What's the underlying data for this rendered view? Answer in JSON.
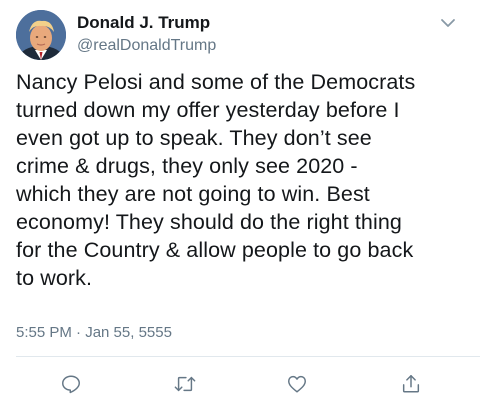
{
  "author": {
    "name": "Donald J. Trump",
    "handle": "@realDonaldTrump"
  },
  "tweet": {
    "text": "Nancy Pelosi and some of the Democrats\nturned down my offer yesterday before I\neven got up to speak. They don’t see\ncrime & drugs, they only see 2020 -\nwhich they are not going to win. Best\neconomy! They should do the right thing\nfor the Country & allow people to go back\nto work.",
    "timestamp": "5:55 PM · Jan 55, 5555"
  },
  "icons": {
    "menu": "chevron-down-icon",
    "reply": "reply-icon",
    "retweet": "retweet-icon",
    "like": "heart-icon",
    "share": "share-icon"
  },
  "colors": {
    "text": "#14171a",
    "secondary": "#657786",
    "divider": "#e1e8ed"
  }
}
